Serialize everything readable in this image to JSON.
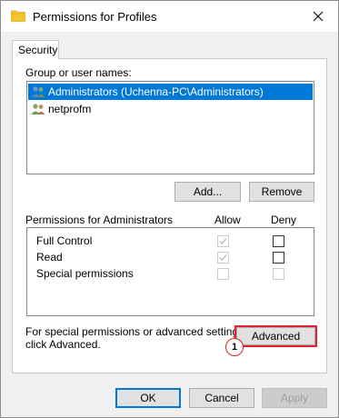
{
  "window": {
    "title": "Permissions for Profiles",
    "icon": "folder-icon",
    "close_glyph": "✕"
  },
  "tabs": [
    {
      "label": "Security"
    }
  ],
  "groups": {
    "heading": "Group or user names:",
    "items": [
      {
        "label": "Administrators (Uchenna-PC\\Administrators)",
        "selected": true,
        "icon": "users-group-icon"
      },
      {
        "label": "netprofm",
        "selected": false,
        "icon": "user-icon"
      }
    ],
    "add_label": "Add...",
    "remove_label": "Remove"
  },
  "permissions": {
    "heading": "Permissions for Administrators",
    "allow_header": "Allow",
    "deny_header": "Deny",
    "rows": [
      {
        "label": "Full Control",
        "allow": true,
        "allow_enabled": false,
        "deny": false,
        "deny_enabled": true
      },
      {
        "label": "Read",
        "allow": true,
        "allow_enabled": false,
        "deny": false,
        "deny_enabled": true
      },
      {
        "label": "Special permissions",
        "allow": false,
        "allow_enabled": false,
        "deny": false,
        "deny_enabled": false
      }
    ]
  },
  "advanced": {
    "note_line1": "For special permissions or advanced settings,",
    "note_line2": "click Advanced.",
    "button_label": "Advanced",
    "callout_number": "1",
    "highlight_color": "#e3202c"
  },
  "footer": {
    "ok_label": "OK",
    "cancel_label": "Cancel",
    "apply_label": "Apply"
  },
  "colors": {
    "selection": "#0078d7",
    "default_button_border": "#0078d7"
  }
}
